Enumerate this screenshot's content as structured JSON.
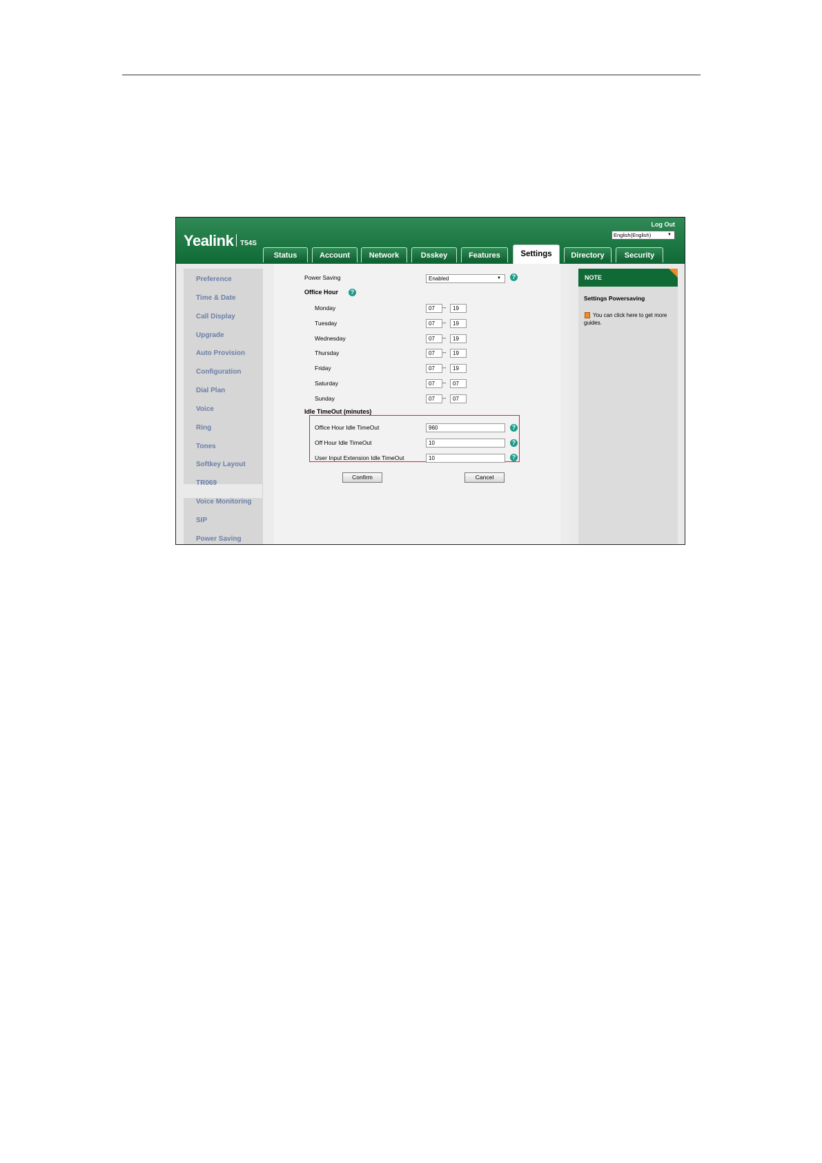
{
  "header": {
    "logo": "Yealink",
    "model": "T54S",
    "logout_label": "Log Out",
    "language_value": "English(English)"
  },
  "tabs": [
    "Status",
    "Account",
    "Network",
    "Dsskey",
    "Features",
    "Settings",
    "Directory",
    "Security"
  ],
  "active_tab": "Settings",
  "sidebar": {
    "items": [
      "Preference",
      "Time & Date",
      "Call Display",
      "Upgrade",
      "Auto Provision",
      "Configuration",
      "Dial Plan",
      "Voice",
      "Ring",
      "Tones",
      "Softkey Layout",
      "TR069",
      "Voice Monitoring",
      "SIP",
      "Power Saving"
    ],
    "active": "Power Saving"
  },
  "form": {
    "power_saving_label": "Power Saving",
    "power_saving_value": "Enabled",
    "office_hour_label": "Office Hour",
    "days": [
      {
        "day": "Monday",
        "start": "07",
        "end": "19"
      },
      {
        "day": "Tuesday",
        "start": "07",
        "end": "19"
      },
      {
        "day": "Wednesday",
        "start": "07",
        "end": "19"
      },
      {
        "day": "Thursday",
        "start": "07",
        "end": "19"
      },
      {
        "day": "Friday",
        "start": "07",
        "end": "19"
      },
      {
        "day": "Saturday",
        "start": "07",
        "end": "07"
      },
      {
        "day": "Sunday",
        "start": "07",
        "end": "07"
      }
    ],
    "separator": "--",
    "idle_timeout_label": "Idle TimeOut (minutes)",
    "office_hour_idle_label": "Office Hour Idle TimeOut",
    "office_hour_idle_value": "960",
    "off_hour_idle_label": "Off Hour Idle TimeOut",
    "off_hour_idle_value": "10",
    "user_input_idle_label": "User Input Extension Idle TimeOut",
    "user_input_idle_value": "10",
    "confirm_label": "Confirm",
    "cancel_label": "Cancel",
    "help_glyph": "?"
  },
  "note": {
    "header": "NOTE",
    "title": "Settings Powersaving",
    "text": "You can click here to get more guides."
  },
  "colors": {
    "header_green": "#0f6a35",
    "sidebar_link": "#6b7fa7",
    "highlight_red": "#d9232e",
    "note_orange": "#f08a24",
    "help_teal": "#1a9a8a"
  }
}
